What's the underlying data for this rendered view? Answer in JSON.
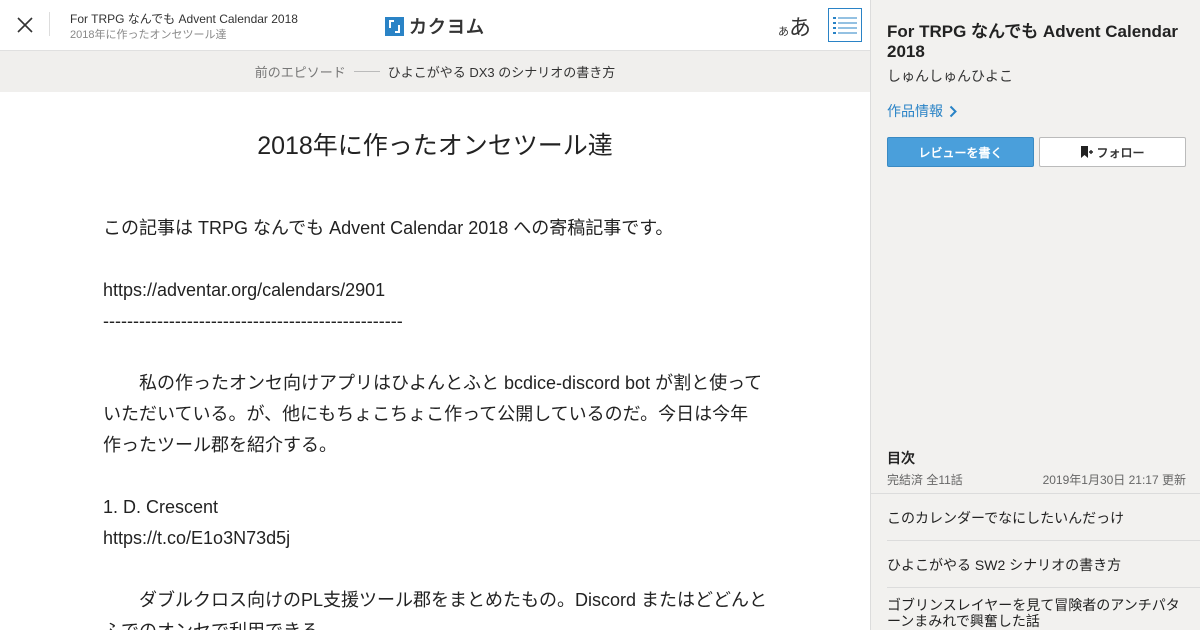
{
  "header": {
    "work_title": "For TRPG なんでも Advent Calendar 2018",
    "episode_title": "2018年に作ったオンセツール達",
    "logo_text": "カクヨム",
    "font_small": "あ",
    "font_big": "あ"
  },
  "episode_nav": {
    "prev_label": "前のエピソード",
    "prev_title": "ひよこがやる DX3 のシナリオの書き方"
  },
  "episode": {
    "title": "2018年に作ったオンセツール達",
    "lines": [
      "この記事は TRPG なんでも Advent Calendar 2018 への寄稿記事です。",
      "",
      "https://adventar.org/calendars/2901",
      "--------------------------------------------------",
      "",
      "私の作ったオンセ向けアプリはひよんとふと bcdice-discord bot が割と使って",
      "いただいている。が、他にもちょこちょこ作って公開しているのだ。今日は今年",
      "作ったツール郡を紹介する。",
      "",
      "1. D. Crescent",
      "https://t.co/E1o3N73d5j",
      "",
      "ダブルクロス向けのPL支援ツール郡をまとめたもの。Discord またはどどんと",
      "ふでのオンセで利用できる。"
    ]
  },
  "sidebar": {
    "work_title": "For TRPG なんでも Advent Calendar 2018",
    "author": "しゅんしゅんひよこ",
    "work_info_link": "作品情報",
    "review_button": "レビューを書く",
    "follow_button": "フォロー",
    "toc_heading": "目次",
    "toc_status": "完結済 全11話",
    "toc_updated": "2019年1月30日 21:17 更新",
    "toc_items": [
      "このカレンダーでなにしたいんだっけ",
      "ひよこがやる SW2 シナリオの書き方",
      "ゴブリンスレイヤーを見て冒険者のアンチパターンまみれで興奮した話"
    ]
  },
  "colors": {
    "accent": "#2a83c6",
    "review_button_bg": "#4a9fdb",
    "sidebar_bg": "#f2f1ef",
    "nav_bg": "#f0efed"
  },
  "icons": {
    "close": "close-icon",
    "toc": "list-icon",
    "chevron": "chevron-right-icon",
    "bookmark": "bookmark-plus-icon"
  }
}
